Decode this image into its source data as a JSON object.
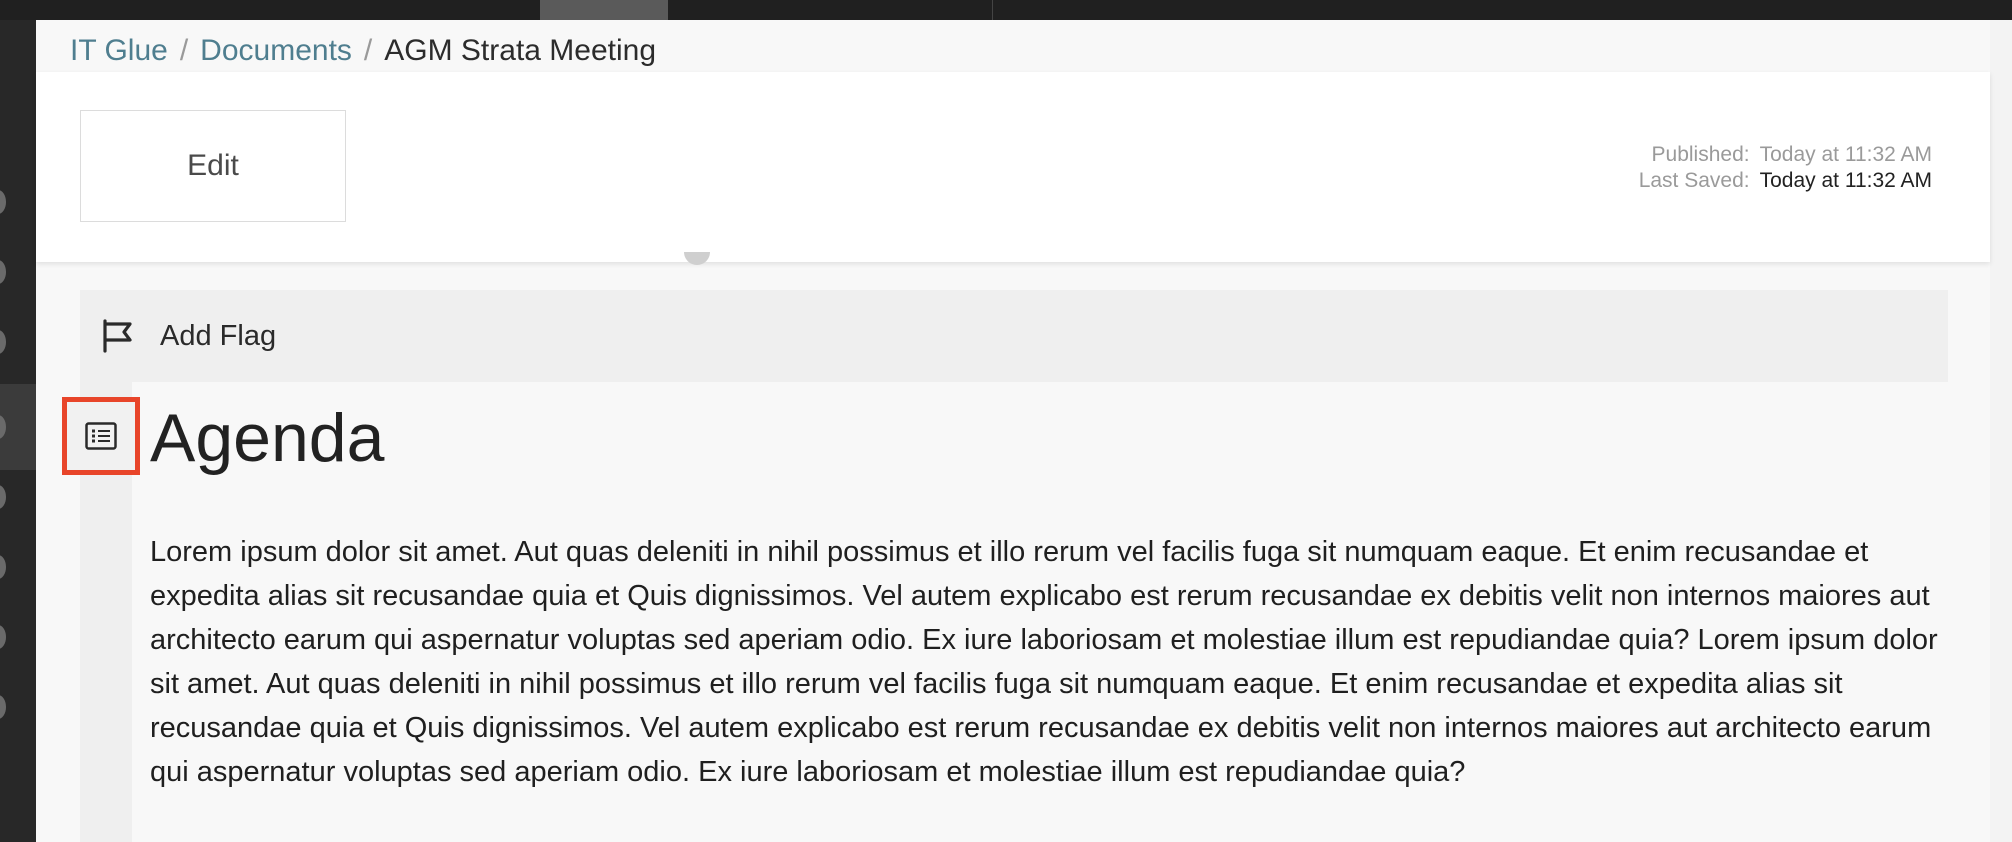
{
  "breadcrumb": {
    "items": [
      {
        "label": "IT Glue"
      },
      {
        "label": "Documents"
      },
      {
        "label": "AGM Strata Meeting"
      }
    ],
    "separator": "/"
  },
  "header": {
    "edit_label": "Edit",
    "published_label": "Published:",
    "published_value": "Today at 11:32 AM",
    "last_saved_label": "Last Saved:",
    "last_saved_value": "Today at 11:32 AM"
  },
  "flag": {
    "label": "Add Flag",
    "icon": "flag-icon"
  },
  "section": {
    "icon": "list-icon",
    "title": "Agenda",
    "body": "Lorem ipsum dolor sit amet. Aut quas deleniti in nihil possimus et illo rerum vel facilis fuga sit numquam eaque. Et enim recusandae et expedita alias sit recusandae quia et Quis dignissimos. Vel autem explicabo est rerum recusandae ex debitis velit non internos maiores aut architecto earum qui aspernatur voluptas sed aperiam odio. Ex iure laboriosam et molestiae illum est repudiandae quia? Lorem ipsum dolor sit amet. Aut quas deleniti in nihil possimus et illo rerum vel facilis fuga sit numquam eaque. Et enim recusandae et expedita alias sit recusandae quia et Quis dignissimos. Vel autem explicabo est rerum recusandae ex debitis velit non internos maiores aut architecto earum qui aspernatur voluptas sed aperiam odio. Ex iure laboriosam et molestiae illum est repudiandae quia?"
  },
  "colors": {
    "link": "#4f7e8f",
    "highlight": "#e8452a",
    "sidebar": "#282828"
  }
}
